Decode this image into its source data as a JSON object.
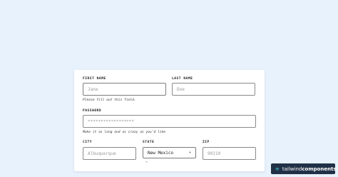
{
  "form": {
    "first_name": {
      "label": "FIRST NAME",
      "placeholder": "Jane",
      "help": "Please fill out this field."
    },
    "last_name": {
      "label": "LAST NAME",
      "placeholder": "Doe"
    },
    "password": {
      "label": "PASSWORD",
      "placeholder": "******************",
      "help": "Make it as long and as crazy as you'd like"
    },
    "city": {
      "label": "CITY",
      "placeholder": "Albuquerque"
    },
    "state": {
      "label": "STATE",
      "value": "New Mexico"
    },
    "zip": {
      "label": "ZIP",
      "placeholder": "90210"
    }
  },
  "icons": {
    "state_dropdown": "chevron-down-icon",
    "brand_mark": "tailwind-logo-icon"
  },
  "brand": {
    "text_light": "tailwind",
    "text_bold": "components"
  },
  "colors": {
    "page_background": "#e8f2fc",
    "brand_background": "#203046",
    "brand_accent": "#3ec9d6"
  }
}
